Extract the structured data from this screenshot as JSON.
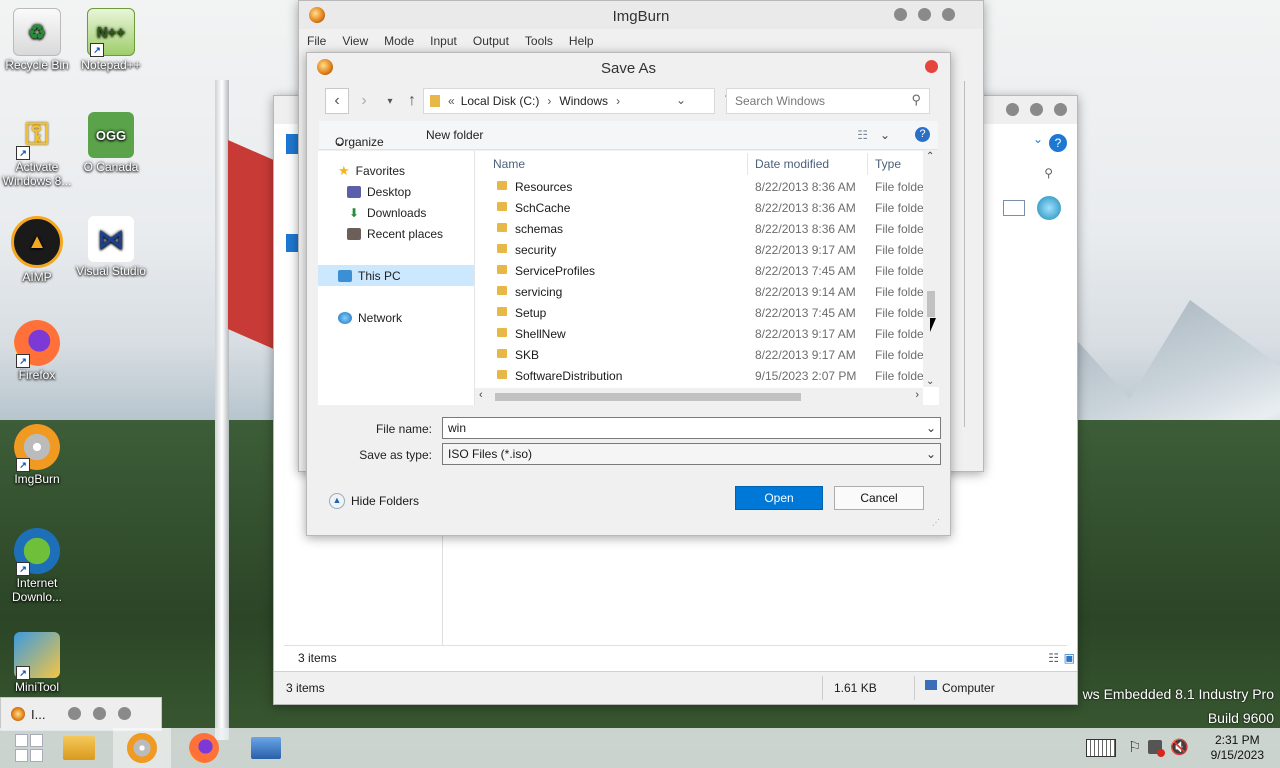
{
  "desktop_icons": [
    {
      "label": "Recycle Bin",
      "icon": "recycle-bin-icon"
    },
    {
      "label": "Notepad++",
      "icon": "notepad-plus-plus-icon"
    },
    {
      "label": "Activate Windows 8...",
      "icon": "activate-windows-key-icon"
    },
    {
      "label": "O Canada",
      "icon": "ogg-file-icon",
      "badge": "OGG"
    },
    {
      "label": "AIMP",
      "icon": "aimp-icon"
    },
    {
      "label": "Visual Studio",
      "icon": "visual-studio-icon"
    },
    {
      "label": "Firefox",
      "icon": "firefox-icon"
    },
    {
      "label": "ImgBurn",
      "icon": "imgburn-icon"
    },
    {
      "label": "Internet Downlo...",
      "icon": "internet-download-manager-icon"
    },
    {
      "label": "MiniTool",
      "icon": "minitool-icon"
    }
  ],
  "imgburn": {
    "title": "ImgBurn",
    "menu": [
      "File",
      "View",
      "Mode",
      "Input",
      "Output",
      "Tools",
      "Help"
    ]
  },
  "explorer": {
    "status_items": "3 items",
    "status_items2": "3 items",
    "size": "1.61 KB",
    "location": "Computer"
  },
  "save_as": {
    "title": "Save As",
    "breadcrumb": [
      "«",
      "Local Disk (C:)",
      "Windows"
    ],
    "search_placeholder": "Search Windows",
    "organize": "Organize",
    "new_folder": "New folder",
    "nav": {
      "favorites": "Favorites",
      "desktop": "Desktop",
      "downloads": "Downloads",
      "recent": "Recent places",
      "this_pc": "This PC",
      "network": "Network"
    },
    "columns": {
      "name": "Name",
      "date": "Date modified",
      "type": "Type"
    },
    "rows": [
      {
        "name": "Resources",
        "date": "8/22/2013 8:36 AM",
        "type": "File folder"
      },
      {
        "name": "SchCache",
        "date": "8/22/2013 8:36 AM",
        "type": "File folder"
      },
      {
        "name": "schemas",
        "date": "8/22/2013 8:36 AM",
        "type": "File folder"
      },
      {
        "name": "security",
        "date": "8/22/2013 9:17 AM",
        "type": "File folder"
      },
      {
        "name": "ServiceProfiles",
        "date": "8/22/2013 7:45 AM",
        "type": "File folder"
      },
      {
        "name": "servicing",
        "date": "8/22/2013 9:14 AM",
        "type": "File folder"
      },
      {
        "name": "Setup",
        "date": "8/22/2013 7:45 AM",
        "type": "File folder"
      },
      {
        "name": "ShellNew",
        "date": "8/22/2013 9:17 AM",
        "type": "File folder"
      },
      {
        "name": "SKB",
        "date": "8/22/2013 9:17 AM",
        "type": "File folder"
      },
      {
        "name": "SoftwareDistribution",
        "date": "9/15/2023 2:07 PM",
        "type": "File folder"
      }
    ],
    "file_name_label": "File name:",
    "file_name_value": "win",
    "save_type_label": "Save as type:",
    "save_type_value": "ISO Files (*.iso)",
    "hide_folders": "Hide Folders",
    "open": "Open",
    "cancel": "Cancel"
  },
  "taskbar": {
    "mini_title": "I...",
    "time": "2:31 PM",
    "date": "9/15/2023"
  },
  "watermark": {
    "line1": "ws Embedded 8.1 Industry Pro",
    "line2": "Build 9600"
  }
}
